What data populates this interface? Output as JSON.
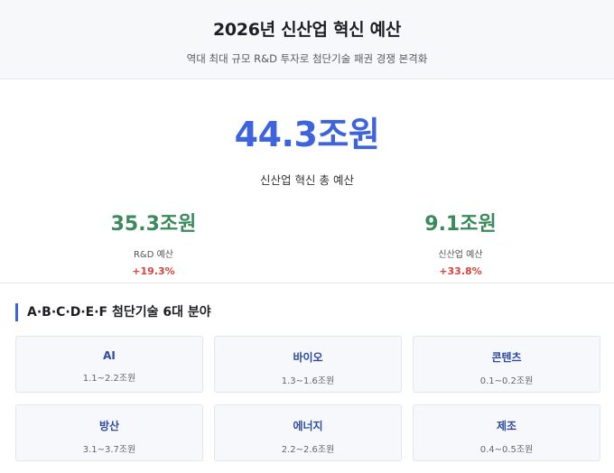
{
  "header": {
    "title": "2026년 신산업 혁신 예산",
    "subtitle": "역대 최대 규모 R&D 투자로 첨단기술 패권 경쟁 본격화"
  },
  "summary": {
    "total_amount": "44.3조원",
    "total_label": "신산업 혁신 총 예산",
    "rnd": {
      "amount": "35.3조원",
      "label": "R&D 예산",
      "change": "+19.3%"
    },
    "industry": {
      "amount": "9.1조원",
      "label": "신산업 예산",
      "change": "+33.8%"
    }
  },
  "fields": {
    "heading": "A·B·C·D·E·F 첨단기술 6대 분야",
    "items": [
      {
        "name": "AI",
        "range": "1.1~2.2조원"
      },
      {
        "name": "바이오",
        "range": "1.3~1.6조원"
      },
      {
        "name": "콘텐츠",
        "range": "0.1~0.2조원"
      },
      {
        "name": "방산",
        "range": "3.1~3.7조원"
      },
      {
        "name": "에너지",
        "range": "2.2~2.6조원"
      },
      {
        "name": "제조",
        "range": "0.4~0.5조원"
      }
    ]
  },
  "colors": {
    "accent_blue": "#3d63dd",
    "amount_green": "#3a8a5c",
    "change_red": "#d6453c",
    "card_title": "#2d4a9c"
  }
}
